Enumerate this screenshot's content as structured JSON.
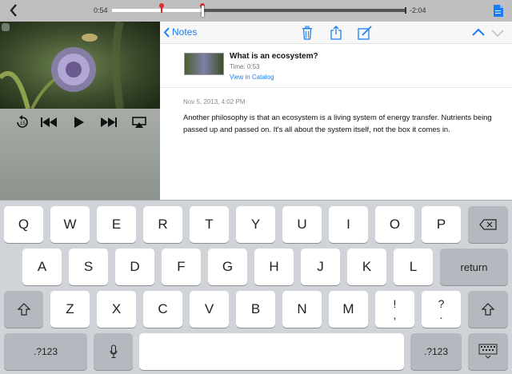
{
  "player": {
    "elapsed": "0:54",
    "remaining": "-2:04",
    "played_fraction": 0.31,
    "markers": [
      0.17,
      0.31
    ]
  },
  "notes_panel": {
    "back_label": "Notes",
    "note": {
      "title": "What is an ecosystem?",
      "time": "Time: 0:53",
      "catalog_link": "View in Catalog",
      "date": "Nov 5, 2013, 4:02 PM",
      "body": "Another philosophy is that an ecosystem is a living system of energy transfer. Nutrients being passed up and passed on. It's all about the system itself, not the box it comes in."
    }
  },
  "keyboard": {
    "row1": [
      "Q",
      "W",
      "E",
      "R",
      "T",
      "Y",
      "U",
      "I",
      "O",
      "P"
    ],
    "row2": [
      "A",
      "S",
      "D",
      "F",
      "G",
      "H",
      "J",
      "K",
      "L"
    ],
    "row3": [
      "Z",
      "X",
      "C",
      "V",
      "B",
      "N",
      "M"
    ],
    "punct1": [
      "!",
      ","
    ],
    "punct2": [
      "?",
      "."
    ],
    "return_label": "return",
    "numbers_label": ".?123"
  },
  "colors": {
    "accent": "#1a7cf5",
    "marker": "#e02b2b"
  }
}
